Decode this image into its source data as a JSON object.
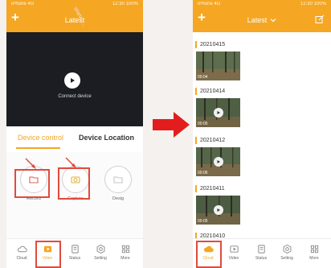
{
  "left_phone": {
    "status_left": "iPhone 4G",
    "status_right": "12:30 100%",
    "title": "Latest",
    "video": {
      "caption": "Connect device"
    },
    "tabs": [
      {
        "label": "Device control",
        "active": true
      },
      {
        "label": "Device Location",
        "active": false
      }
    ],
    "actions": [
      {
        "label": "Record",
        "icon": "folder-icon",
        "highlighted": true
      },
      {
        "label": "Capture",
        "icon": "camera-icon",
        "highlighted": true
      },
      {
        "label": "Desig",
        "icon": "folder-icon",
        "highlighted": false
      }
    ],
    "nav": [
      {
        "label": "Cloud",
        "icon": "cloud-icon"
      },
      {
        "label": "Video",
        "icon": "video-icon",
        "active": true
      },
      {
        "label": "Status",
        "icon": "status-icon"
      },
      {
        "label": "Setting",
        "icon": "gear-icon"
      },
      {
        "label": "More",
        "icon": "grid-icon"
      }
    ]
  },
  "right_phone": {
    "status_left": "iPhone 4G",
    "status_right": "12:30 100%",
    "title": "Latest",
    "groups": [
      {
        "date": "20210415",
        "duration": "00:04"
      },
      {
        "date": "20210414",
        "duration": "00:05"
      },
      {
        "date": "20210412",
        "duration": "00:06"
      },
      {
        "date": "20210411",
        "duration": "00:05"
      },
      {
        "date": "20210410",
        "duration": ""
      }
    ],
    "nav": [
      {
        "label": "Cloud",
        "icon": "cloud-icon",
        "active": true
      },
      {
        "label": "Video",
        "icon": "video-icon"
      },
      {
        "label": "Status",
        "icon": "status-icon"
      },
      {
        "label": "Setting",
        "icon": "gear-icon"
      },
      {
        "label": "More",
        "icon": "grid-icon"
      }
    ]
  },
  "watermark": "www.…",
  "colors": {
    "accent": "#f5a623",
    "highlight": "#e24a3b",
    "arrow": "#e31d1d"
  }
}
